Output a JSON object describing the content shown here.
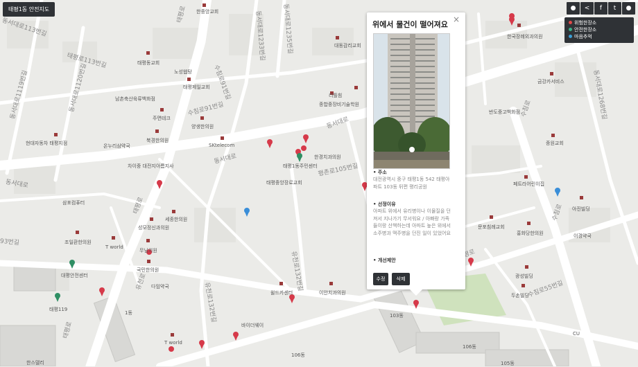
{
  "header": {
    "title": "태평1동 안전지도"
  },
  "toolbar": {
    "icons": [
      "user-icon",
      "share-icon",
      "facebook-icon",
      "twitter-icon",
      "location-pin-icon"
    ]
  },
  "legend": {
    "items": [
      {
        "label": "위험한장소",
        "color": "#e04848"
      },
      {
        "label": "안전한장소",
        "color": "#39b087"
      },
      {
        "label": "마음추억",
        "color": "#3a9fd8"
      }
    ]
  },
  "popup": {
    "title": "위에서 물건이 떨어져요",
    "close": "×",
    "address_label": "• 주소",
    "address": "대전광역시 중구 태평1동 542 태평아파트 103동 뒤편 평리공원",
    "reason_label": "• 선정이유",
    "reason": "아파트 위에서 유리병이나 이물질을 던져서 지나가기 무서워요 / 아빠랑 가족들이랑 산책하는데 아파트 높은 위에서 소주병과 맥주병을 던진 일이 있었어요",
    "improve_label": "• 개선제안",
    "edit_label": "수정",
    "delete_label": "삭제"
  },
  "map": {
    "place_labels": [
      {
        "t": "한중앙교회"
      },
      {
        "t": "대동감리교회"
      },
      {
        "t": "태평동교회"
      },
      {
        "t": "노성웹탕"
      },
      {
        "t": "태평제일교회"
      },
      {
        "t": "남촌축산육류백화점"
      },
      {
        "t": "주면테크"
      },
      {
        "t": "양생한의원"
      },
      {
        "t": "현대자동차 태평지점"
      },
      {
        "t": "온누리삼약국"
      },
      {
        "t": "북경한의원"
      },
      {
        "t": "SKtelecom"
      },
      {
        "t": "차이중 대전지아름지사"
      },
      {
        "t": "태평1동주민센터"
      },
      {
        "t": "태평중앙장로교회"
      },
      {
        "t": "한경치과의원"
      },
      {
        "t": "평화상"
      },
      {
        "t": "순복음대전교회"
      },
      {
        "t": "리틀힘"
      },
      {
        "t": "종합중장비기술학원"
      },
      {
        "t": "삼포컴퓨터"
      },
      {
        "t": "세종한의원"
      },
      {
        "t": "성모정신과의원"
      },
      {
        "t": "조일환한의원"
      },
      {
        "t": "T world"
      },
      {
        "t": "무님의원"
      },
      {
        "t": "국민한의원"
      },
      {
        "t": "다임약국"
      },
      {
        "t": "대평안전센터"
      },
      {
        "t": "태평119"
      },
      {
        "t": "윌드카센터"
      },
      {
        "t": "이안치과의원"
      },
      {
        "t": "바이더웨이"
      },
      {
        "t": "T world"
      },
      {
        "t": "한스델리"
      },
      {
        "t": "106동"
      },
      {
        "t": "106동"
      },
      {
        "t": "105동"
      },
      {
        "t": "103동"
      },
      {
        "t": "1동"
      },
      {
        "t": "한국장례외과의원"
      },
      {
        "t": "금강카서비스"
      },
      {
        "t": "반도중고백화점"
      },
      {
        "t": "종원교회"
      },
      {
        "t": "페트라어린이집"
      },
      {
        "t": "아진빌딩"
      },
      {
        "t": "문포침례교회"
      },
      {
        "t": "홍화당한의원"
      },
      {
        "t": "이경약국"
      },
      {
        "t": "광성빌딩"
      },
      {
        "t": "두손빌딩"
      },
      {
        "t": "CU"
      }
    ],
    "road_labels": [
      {
        "t": "동서대로113번길"
      },
      {
        "t": "태평로113번길"
      },
      {
        "t": "동서대로1119번길"
      },
      {
        "t": "동서대로1120번길"
      },
      {
        "t": "수침로91번길"
      },
      {
        "t": "수침로91번길"
      },
      {
        "t": "동서대로"
      },
      {
        "t": "동서대로"
      },
      {
        "t": "동서대로"
      },
      {
        "t": "태평로"
      },
      {
        "t": "태평로"
      },
      {
        "t": "평촌로105번길"
      },
      {
        "t": "유천로132번길"
      },
      {
        "t": "유천로132번길"
      },
      {
        "t": "유천로"
      },
      {
        "t": "동서대로1233번길"
      },
      {
        "t": "동서대로1235번길"
      },
      {
        "t": "태평로"
      },
      {
        "t": "수침로55번길"
      },
      {
        "t": "수침로"
      },
      {
        "t": "수침로"
      },
      {
        "t": "동서대로1268번길"
      },
      {
        "t": "93번길"
      },
      {
        "t": "태평로"
      }
    ]
  }
}
